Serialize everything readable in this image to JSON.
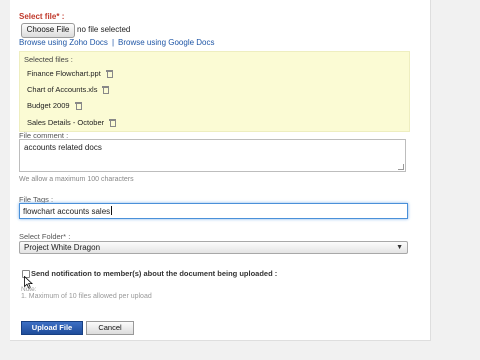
{
  "form": {
    "select_file_label": "Select file* :",
    "choose_file_button": "Choose File",
    "no_file_text": "no file selected",
    "browse_zoho": "Browse using Zoho Docs",
    "link_separator": "|",
    "browse_google": "Browse using Google Docs",
    "selected_files_title": "Selected files :",
    "selected_files": [
      {
        "name": "Finance Flowchart.ppt",
        "icon": "trash-icon"
      },
      {
        "name": "Chart of Accounts.xls",
        "icon": "trash-icon"
      },
      {
        "name": "Budget 2009",
        "icon": "trash-icon"
      },
      {
        "name": "Sales Details - October",
        "icon": "trash-icon"
      }
    ],
    "file_comment_label": "File comment :",
    "file_comment_value": "accounts related docs",
    "comment_hint": "We allow a maximum 100 characters",
    "file_tags_label": "File Tags :",
    "file_tags_value": "flowchart accounts sales",
    "select_folder_label": "Select Folder* :",
    "folder_value": "Project White Dragon",
    "notify_label": "Send notification to member(s) about the document being uploaded :",
    "note_label": "Note:",
    "note_text": "1. Maximum of 10 files allowed per upload",
    "upload_button": "Upload File",
    "cancel_button": "Cancel"
  },
  "colors": {
    "required_label": "#c0392b",
    "link": "#1f56a6",
    "selected_bg": "#fbfbd4",
    "focus_border": "#4a90d9",
    "primary_button": "#1e4c9a"
  }
}
